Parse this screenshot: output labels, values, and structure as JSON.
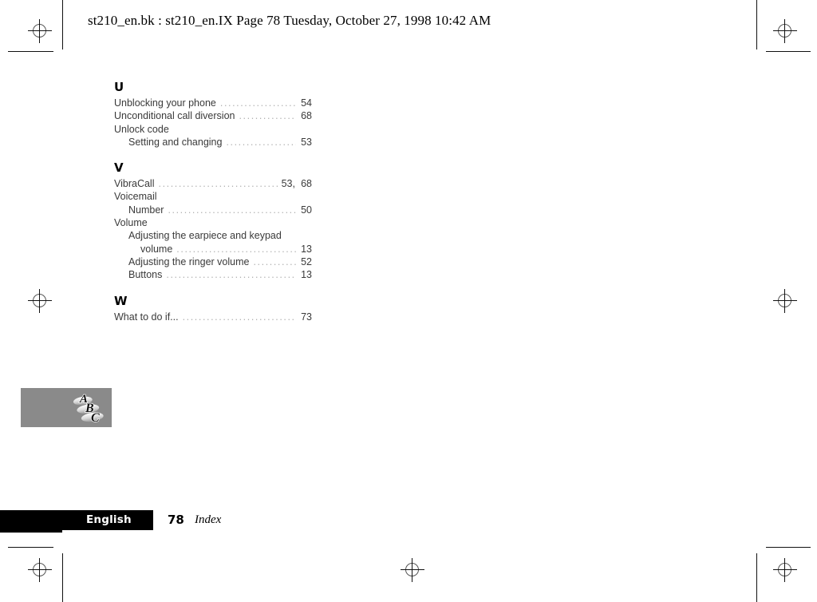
{
  "header": {
    "text": "st210_en.bk : st210_en.IX  Page 78  Tuesday, October 27, 1998  10:42 AM"
  },
  "index": {
    "sections": [
      {
        "letter": "U",
        "entries": [
          {
            "label": "Unblocking your phone",
            "page": "54",
            "level": 0,
            "extra": ""
          },
          {
            "label": "Unconditional call diversion",
            "page": "68",
            "level": 0,
            "extra": ""
          },
          {
            "label": "Unlock code",
            "page": "",
            "level": 0,
            "extra": ""
          },
          {
            "label": "Setting and changing",
            "page": "53",
            "level": 1,
            "extra": ""
          }
        ]
      },
      {
        "letter": "V",
        "entries": [
          {
            "label": "VibraCall",
            "page": "68",
            "level": 0,
            "extra": "53,"
          },
          {
            "label": "Voicemail",
            "page": "",
            "level": 0,
            "extra": ""
          },
          {
            "label": "Number",
            "page": "50",
            "level": 1,
            "extra": ""
          },
          {
            "label": "Volume",
            "page": "",
            "level": 0,
            "extra": ""
          },
          {
            "label": "Adjusting the earpiece and keypad",
            "page": "",
            "level": 1,
            "extra": ""
          },
          {
            "label": "volume",
            "page": "13",
            "level": 2,
            "extra": ""
          },
          {
            "label": "Adjusting the ringer volume",
            "page": "52",
            "level": 1,
            "extra": ""
          },
          {
            "label": "Buttons",
            "page": "13",
            "level": 1,
            "extra": ""
          }
        ]
      },
      {
        "letter": "W",
        "entries": [
          {
            "label": "What to do if...",
            "page": "73",
            "level": 0,
            "extra": ""
          }
        ]
      }
    ]
  },
  "thumb_tab": {
    "logo_letters": [
      "A",
      "B",
      "C"
    ],
    "background_color": "#8a8a8a"
  },
  "footer": {
    "language": "English",
    "page_number": "78",
    "section_name": "Index",
    "bar_color": "#000000"
  },
  "printer_marks": {
    "registration_icon": "registration-crosshair-icon",
    "count": 8
  }
}
